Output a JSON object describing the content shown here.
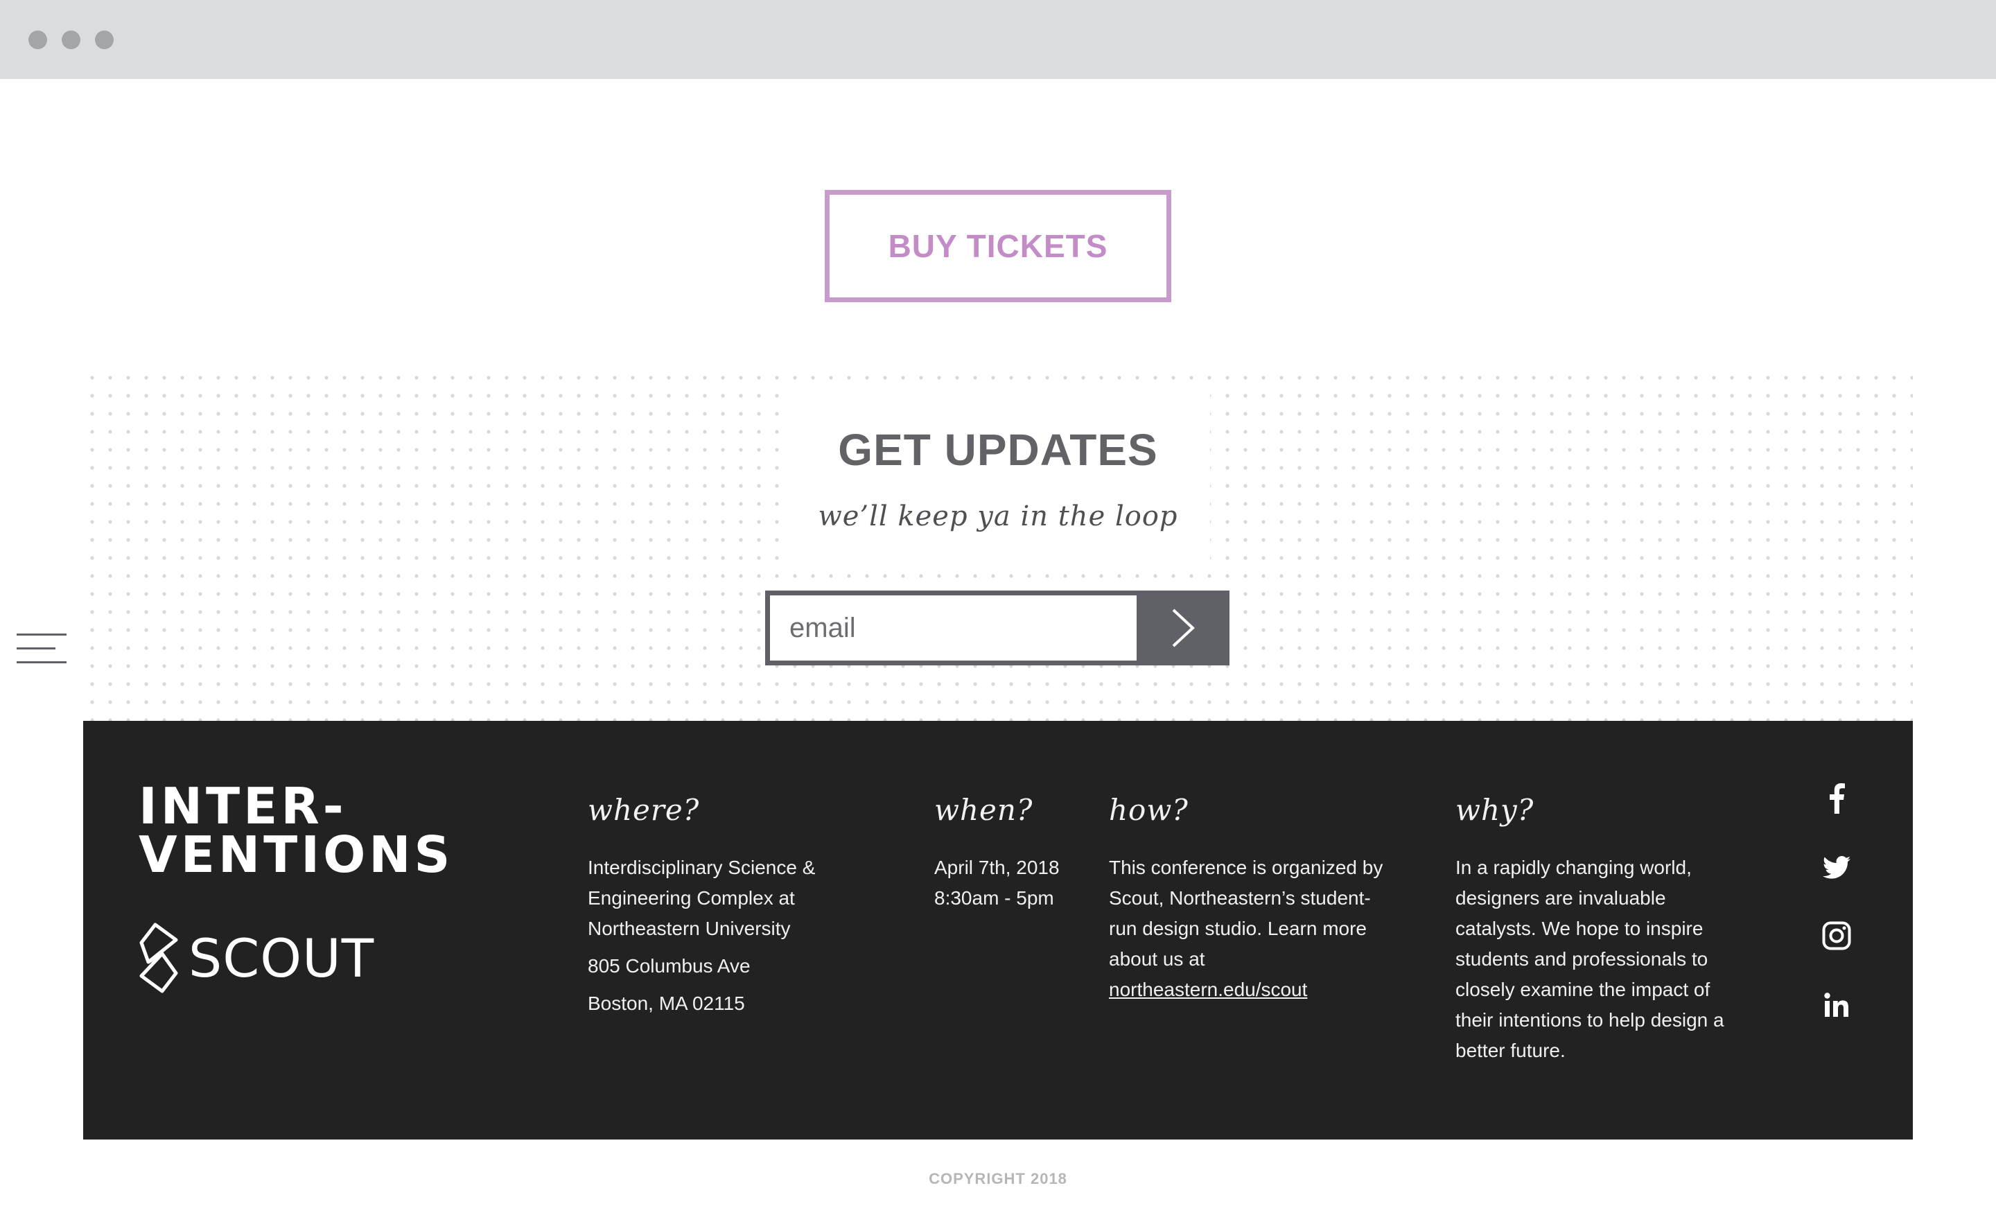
{
  "buy_tickets": {
    "label": "BUY TICKETS"
  },
  "updates": {
    "title": "GET UPDATES",
    "subtitle": "we’ll keep ya in the loop",
    "email_placeholder": "email"
  },
  "footer": {
    "brand": {
      "line1": "INTER-",
      "line2": "VENTIONS",
      "logo_word": "SCOUT"
    },
    "where": {
      "heading": "where?",
      "lines": [
        "Interdisciplinary Science &",
        "Engineering Complex at",
        "Northeastern University",
        "805 Columbus Ave",
        "Boston, MA 02115"
      ]
    },
    "when": {
      "heading": "when?",
      "lines": [
        "April 7th, 2018",
        "8:30am - 5pm"
      ]
    },
    "how": {
      "heading": "how?",
      "lines": [
        "This conference is organized by",
        "Scout, Northeastern’s student-",
        "run design studio. Learn more",
        "about us at"
      ],
      "link": "northeastern.edu/scout"
    },
    "why": {
      "heading": "why?",
      "lines": [
        "In a rapidly changing world,",
        "designers are invaluable",
        "catalysts. We hope to inspire",
        "students and professionals to",
        "closely examine the impact of",
        "their intentions to help design a",
        "better future."
      ]
    },
    "social": [
      "facebook-icon",
      "twitter-icon",
      "instagram-icon",
      "linkedin-icon"
    ]
  },
  "copyright": "COPYRIGHT 2018",
  "colors": {
    "accent": "#c48cc7",
    "chrome": "#dadddd",
    "footer_bg": "#222222",
    "heading_gray": "#616366"
  }
}
